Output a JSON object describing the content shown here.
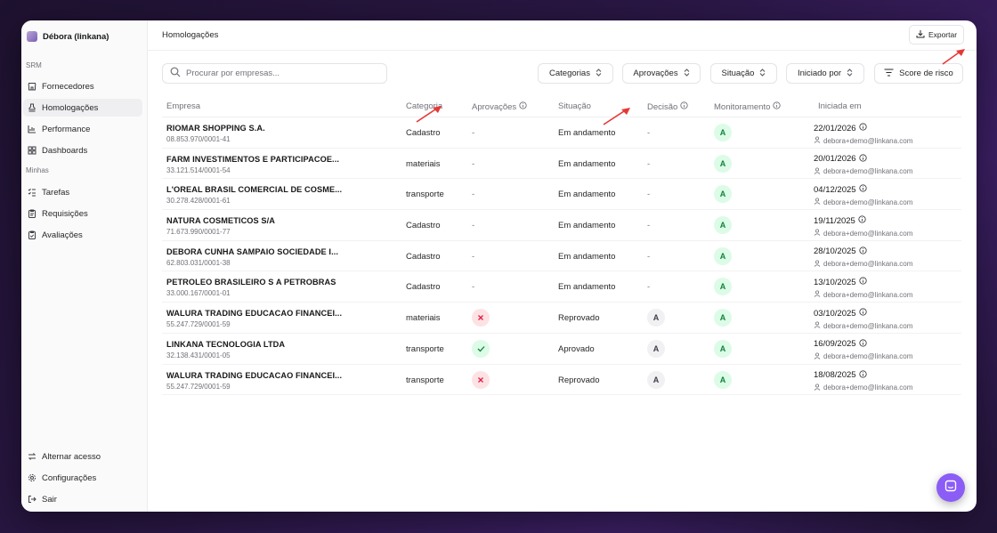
{
  "workspace": {
    "name": "Débora (linkana)"
  },
  "sidebar": {
    "section_srm": "SRM",
    "section_minhas": "Minhas",
    "srm_items": [
      {
        "label": "Fornecedores",
        "icon": "store-icon"
      },
      {
        "label": "Homologações",
        "icon": "stamp-icon"
      },
      {
        "label": "Performance",
        "icon": "bar-chart-icon"
      },
      {
        "label": "Dashboards",
        "icon": "dashboard-icon"
      }
    ],
    "minhas_items": [
      {
        "label": "Tarefas",
        "icon": "list-checks-icon"
      },
      {
        "label": "Requisições",
        "icon": "clipboard-icon"
      },
      {
        "label": "Avaliações",
        "icon": "clipboard-check-icon"
      }
    ],
    "bottom_items": [
      {
        "label": "Alternar acesso",
        "icon": "switch-icon"
      },
      {
        "label": "Configurações",
        "icon": "gear-icon"
      },
      {
        "label": "Sair",
        "icon": "logout-icon"
      }
    ],
    "active_item": "Homologações"
  },
  "header": {
    "title": "Homologações",
    "export_label": "Exportar"
  },
  "search": {
    "placeholder": "Procurar por empresas..."
  },
  "filters": [
    "Categorias",
    "Aprovações",
    "Situação",
    "Iniciado por"
  ],
  "risk_button": "Score de risco",
  "table": {
    "columns": [
      "Empresa",
      "Categoria",
      "Aprovações",
      "Situação",
      "Decisão",
      "Monitoramento",
      "Iniciada em"
    ],
    "rows": [
      {
        "name": "RIOMAR SHOPPING S.A.",
        "cnpj": "08.853.970/0001-41",
        "categoria": "Cadastro",
        "aprovacoes": "-",
        "situacao": "Em andamento",
        "decisao": "-",
        "monitoramento": "A",
        "data": "22/01/2026",
        "user": "debora+demo@linkana.com"
      },
      {
        "name": "FARM INVESTIMENTOS E PARTICIPACOE...",
        "cnpj": "33.121.514/0001-54",
        "categoria": "materiais",
        "aprovacoes": "-",
        "situacao": "Em andamento",
        "decisao": "-",
        "monitoramento": "A",
        "data": "20/01/2026",
        "user": "debora+demo@linkana.com"
      },
      {
        "name": "L'OREAL BRASIL COMERCIAL DE COSME...",
        "cnpj": "30.278.428/0001-61",
        "categoria": "transporte",
        "aprovacoes": "-",
        "situacao": "Em andamento",
        "decisao": "-",
        "monitoramento": "A",
        "data": "04/12/2025",
        "user": "debora+demo@linkana.com"
      },
      {
        "name": "NATURA COSMETICOS S/A",
        "cnpj": "71.673.990/0001-77",
        "categoria": "Cadastro",
        "aprovacoes": "-",
        "situacao": "Em andamento",
        "decisao": "-",
        "monitoramento": "A",
        "data": "19/11/2025",
        "user": "debora+demo@linkana.com"
      },
      {
        "name": "DEBORA CUNHA SAMPAIO SOCIEDADE I...",
        "cnpj": "62.803.031/0001-38",
        "categoria": "Cadastro",
        "aprovacoes": "-",
        "situacao": "Em andamento",
        "decisao": "-",
        "monitoramento": "A",
        "data": "28/10/2025",
        "user": "debora+demo@linkana.com"
      },
      {
        "name": "PETROLEO BRASILEIRO S A PETROBRAS",
        "cnpj": "33.000.167/0001-01",
        "categoria": "Cadastro",
        "aprovacoes": "-",
        "situacao": "Em andamento",
        "decisao": "-",
        "monitoramento": "A",
        "data": "13/10/2025",
        "user": "debora+demo@linkana.com"
      },
      {
        "name": "WALURA TRADING EDUCACAO FINANCEI...",
        "cnpj": "55.247.729/0001-59",
        "categoria": "materiais",
        "aprovacoes": "x",
        "situacao": "Reprovado",
        "decisao": "A",
        "monitoramento": "A",
        "data": "03/10/2025",
        "user": "debora+demo@linkana.com"
      },
      {
        "name": "LINKANA TECNOLOGIA LTDA",
        "cnpj": "32.138.431/0001-05",
        "categoria": "transporte",
        "aprovacoes": "check",
        "situacao": "Aprovado",
        "decisao": "A",
        "monitoramento": "A",
        "data": "16/09/2025",
        "user": "debora+demo@linkana.com"
      },
      {
        "name": "WALURA TRADING EDUCACAO FINANCEI...",
        "cnpj": "55.247.729/0001-59",
        "categoria": "transporte",
        "aprovacoes": "x",
        "situacao": "Reprovado",
        "decisao": "A",
        "monitoramento": "A",
        "data": "18/08/2025",
        "user": "debora+demo@linkana.com"
      }
    ]
  },
  "colors": {
    "accent": "#8b5cf6",
    "annotation_arrow": "#e53935",
    "status_green": "#15803d",
    "status_red": "#e11d48"
  }
}
